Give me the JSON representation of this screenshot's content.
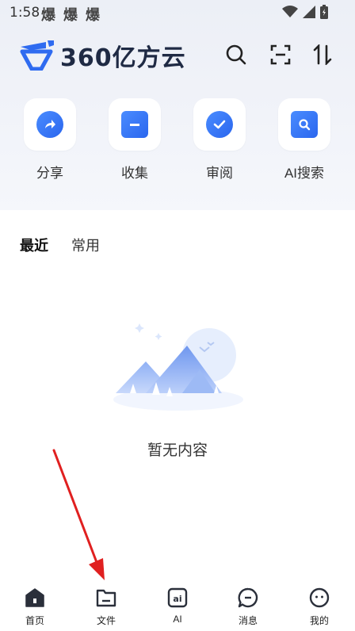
{
  "status_bar": {
    "time": "1:58",
    "notice_icons": [
      "爆",
      "爆",
      "爆"
    ]
  },
  "header": {
    "logo_text": "360亿方云",
    "buttons": [
      "search-icon",
      "scan-icon",
      "sort-icon"
    ]
  },
  "quick_actions": [
    {
      "label": "分享",
      "icon": "share-icon"
    },
    {
      "label": "收集",
      "icon": "collect-icon"
    },
    {
      "label": "审阅",
      "icon": "review-icon"
    },
    {
      "label": "AI搜索",
      "icon": "ai-search-icon"
    }
  ],
  "tabs": [
    {
      "label": "最近",
      "active": true
    },
    {
      "label": "常用",
      "active": false
    }
  ],
  "empty_state": {
    "text": "暂无内容"
  },
  "bottom_nav": [
    {
      "label": "首页",
      "icon": "home-icon"
    },
    {
      "label": "文件",
      "icon": "folder-icon"
    },
    {
      "label": "AI",
      "icon": "ai-icon"
    },
    {
      "label": "消息",
      "icon": "message-icon"
    },
    {
      "label": "我的",
      "icon": "profile-icon"
    }
  ],
  "colors": {
    "accent": "#2f6bf0",
    "annotation_arrow": "#e02020"
  }
}
